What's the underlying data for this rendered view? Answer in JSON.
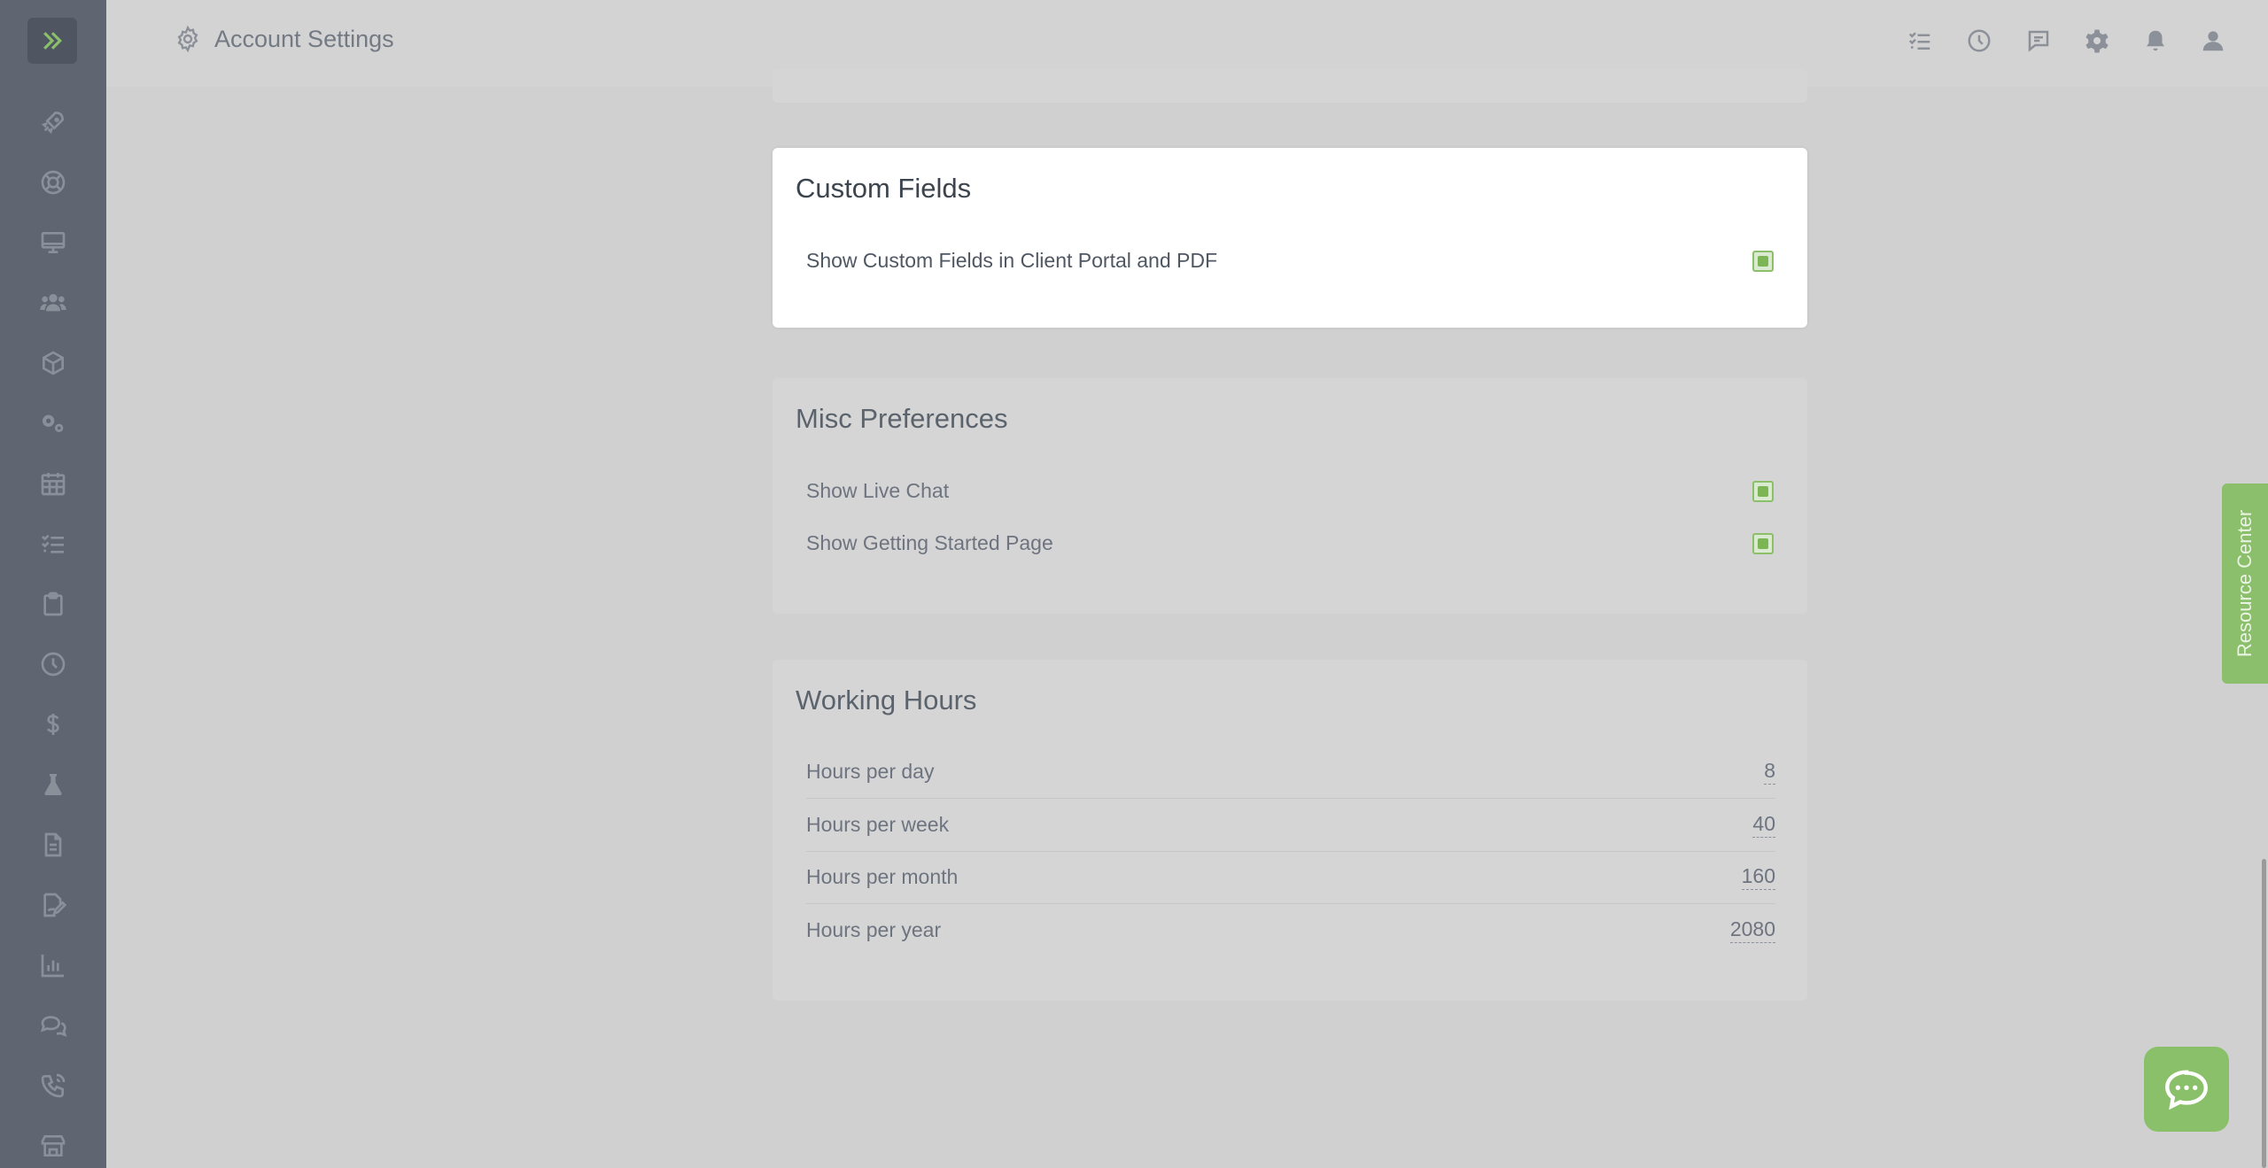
{
  "header": {
    "title": "Account Settings"
  },
  "sidebar": {
    "icons": [
      "rocket-icon",
      "lifebuoy-icon",
      "monitor-icon",
      "users-icon",
      "box-icon",
      "gears-icon",
      "calendar-icon",
      "task-list-icon",
      "clipboard-icon",
      "clock-icon",
      "dollar-icon",
      "flask-icon",
      "document-icon",
      "signature-icon",
      "bar-chart-icon",
      "chat-bubbles-icon",
      "phone-icon",
      "store-icon"
    ]
  },
  "topbar_icons": [
    "task-list-icon",
    "clock-icon",
    "message-icon",
    "gear-icon",
    "bell-icon",
    "user-icon"
  ],
  "custom_fields": {
    "title": "Custom Fields",
    "items": [
      {
        "label": "Show Custom Fields in Client Portal and PDF",
        "checked": true
      }
    ]
  },
  "misc": {
    "title": "Misc Preferences",
    "items": [
      {
        "label": "Show Live Chat",
        "checked": true
      },
      {
        "label": "Show Getting Started Page",
        "checked": true
      }
    ]
  },
  "working_hours": {
    "title": "Working Hours",
    "items": [
      {
        "label": "Hours per day",
        "value": "8"
      },
      {
        "label": "Hours per week",
        "value": "40"
      },
      {
        "label": "Hours per month",
        "value": "160"
      },
      {
        "label": "Hours per year",
        "value": "2080"
      }
    ]
  },
  "resource_center": {
    "label": "Resource Center"
  },
  "colors": {
    "accent": "#8bc06a",
    "sidebar": "#5f6672"
  }
}
